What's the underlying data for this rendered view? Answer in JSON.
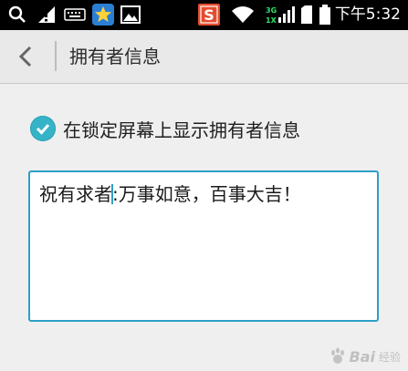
{
  "status_bar": {
    "time": "下午5:32",
    "network_3g": "3G",
    "network_1x": "1X",
    "icons": [
      "search-icon",
      "warning-signal-icon",
      "keyboard-icon",
      "star-app-icon",
      "image-icon",
      "sogou-s-icon",
      "wifi-icon",
      "signal-icon",
      "sim-icon",
      "battery-icon"
    ],
    "sogou_label": "S"
  },
  "action_bar": {
    "title": "拥有者信息"
  },
  "settings": {
    "checkbox_label": "在锁定屏幕上显示拥有者信息",
    "checkbox_checked": true
  },
  "owner_info_field": {
    "text_before_cursor": "祝有求者",
    "text_after_cursor": ":万事如意，百事大吉！"
  },
  "watermark": {
    "text": "Bai",
    "sub": "经验"
  },
  "colors": {
    "accent": "#36b3c7",
    "field_border": "#2c9fc6",
    "sogou": "#e54c2e",
    "star_app": "#2a7fd4"
  }
}
